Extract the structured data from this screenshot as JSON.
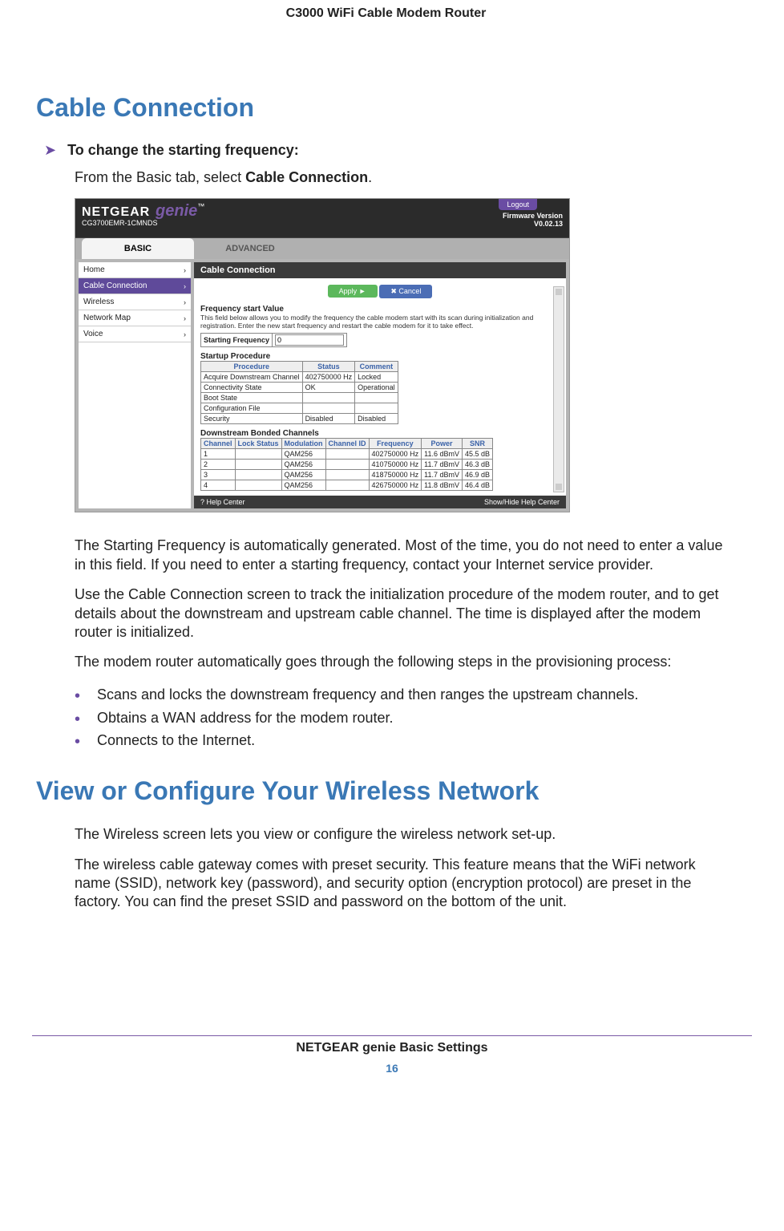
{
  "doc": {
    "product": "C3000 WiFi Cable Modem Router",
    "footer_title": "NETGEAR genie Basic Settings",
    "page_no": "16"
  },
  "section1": {
    "title": "Cable Connection",
    "sub": "To change the starting frequency:",
    "intro_pre": "From the Basic tab, select ",
    "intro_bold": "Cable Connection",
    "intro_post": ".",
    "p1": "The Starting Frequency is automatically generated. Most of the time, you do not need to enter a value in this field. If you need to enter a starting frequency, contact your Internet service provider.",
    "p2": "Use the Cable Connection screen to track the initialization procedure of the modem router, and to get details about the downstream and upstream cable channel. The time is displayed after the modem router is initialized.",
    "p3": "The modem router automatically goes through the following steps in the provisioning process:",
    "bullets": [
      "Scans and locks the downstream frequency and then ranges the upstream channels.",
      "Obtains a WAN address for the modem router.",
      "Connects to the Internet."
    ]
  },
  "section2": {
    "title": "View or Configure Your Wireless Network",
    "p1": "The Wireless screen lets you view or configure the wireless network set-up.",
    "p2": "The wireless cable gateway comes with preset security. This feature means that the WiFi network name (SSID), network key (password), and security option (encryption protocol) are preset in the factory. You can find the preset SSID and password on the bottom of the unit."
  },
  "shot": {
    "brand": "NETGEAR",
    "genie": "genie",
    "tm": "™",
    "model": "CG3700EMR-1CMNDS",
    "logout": "Logout",
    "fw_lbl": "Firmware Version",
    "fw_val": "V0.02.13",
    "tab_basic": "BASIC",
    "tab_adv": "ADVANCED",
    "side": [
      "Home",
      "Cable Connection",
      "Wireless",
      "Network Map",
      "Voice"
    ],
    "panel_title": "Cable Connection",
    "apply": "Apply  ►",
    "cancel": "✖ Cancel",
    "freq_lbl": "Frequency start Value",
    "freq_desc": "This field below allows you to modify the frequency the cable modem start with its scan during initialization and registration. Enter the new start frequency and restart the cable modem for it to take effect.",
    "sf_lbl": "Starting Frequency",
    "sf_val": "0",
    "startup_lbl": "Startup Procedure",
    "startup_head": [
      "Procedure",
      "Status",
      "Comment"
    ],
    "startup_rows": [
      [
        "Acquire Downstream Channel",
        "402750000 Hz",
        "Locked"
      ],
      [
        "Connectivity State",
        "OK",
        "Operational"
      ],
      [
        "Boot State",
        "",
        ""
      ],
      [
        "Configuration File",
        "",
        ""
      ],
      [
        "Security",
        "Disabled",
        "Disabled"
      ]
    ],
    "dbc_lbl": "Downstream Bonded Channels",
    "dbc_head": [
      "Channel",
      "Lock Status",
      "Modulation",
      "Channel ID",
      "Frequency",
      "Power",
      "SNR"
    ],
    "dbc_rows": [
      [
        "1",
        "",
        "QAM256",
        "",
        "402750000 Hz",
        "11.6 dBmV",
        "45.5 dB"
      ],
      [
        "2",
        "",
        "QAM256",
        "",
        "410750000 Hz",
        "11.7 dBmV",
        "46.3 dB"
      ],
      [
        "3",
        "",
        "QAM256",
        "",
        "418750000 Hz",
        "11.7 dBmV",
        "46.9 dB"
      ],
      [
        "4",
        "",
        "QAM256",
        "",
        "426750000 Hz",
        "11.8 dBmV",
        "46.4 dB"
      ]
    ],
    "help": "? Help Center",
    "showhide": "Show/Hide Help Center"
  }
}
